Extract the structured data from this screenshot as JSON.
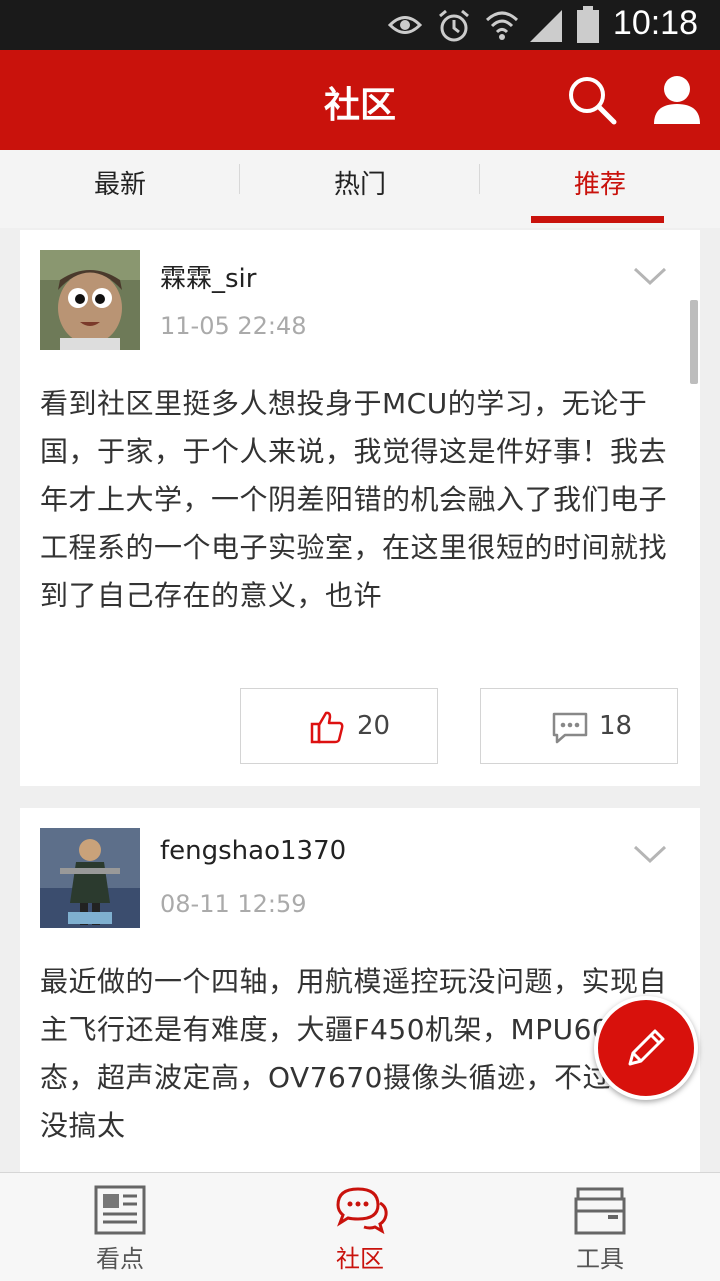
{
  "status_bar": {
    "time": "10:18"
  },
  "header": {
    "title": "社区"
  },
  "tabs": [
    {
      "label": "最新"
    },
    {
      "label": "热门"
    },
    {
      "label": "推荐"
    }
  ],
  "active_tab": "推荐",
  "posts": [
    {
      "username": "霖霖_sir",
      "time": "11-05 22:48",
      "content": "看到社区里挺多人想投身于MCU的学习，无论于国，于家，于个人来说，我觉得这是件好事！我去年才上大学，一个阴差阳错的机会融入了我们电子工程系的一个电子实验室，在这里很短的时间就找到了自己存在的意义，也许",
      "likes": "20",
      "comments": "18"
    },
    {
      "username": "fengshao1370",
      "time": "08-11 12:59",
      "content": "最近做的一个四轴，用航模遥控玩没问题，实现自主飞行还是有难度，大疆F450机架，MPU6050姿态，超声波定高，OV7670摄像头循迹，不过循迹没搞太"
    }
  ],
  "bottom_nav": [
    {
      "label": "看点"
    },
    {
      "label": "社区"
    },
    {
      "label": "工具"
    }
  ],
  "colors": {
    "brand": "#c9120c",
    "background": "#efefef"
  },
  "icons": [
    "eye-icon",
    "alarm-icon",
    "wifi-icon",
    "signal-icon",
    "battery-icon",
    "search-icon",
    "user-icon",
    "chevron-down-icon",
    "thumbs-up-icon",
    "comment-icon",
    "pencil-icon",
    "news-icon",
    "chat-bubbles-icon",
    "toolbox-icon"
  ]
}
